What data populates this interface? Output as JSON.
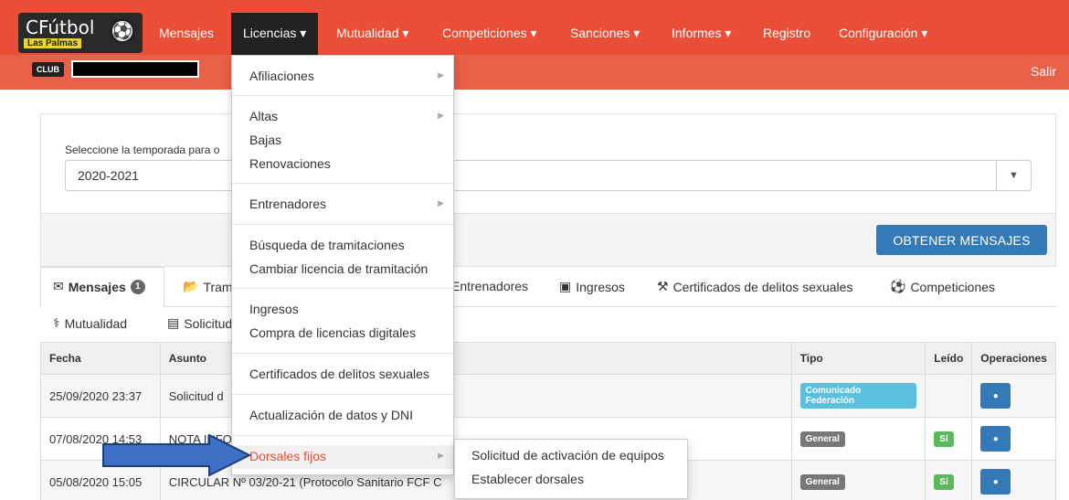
{
  "brand": {
    "title": "CFútbol",
    "subtitle": "Las Palmas"
  },
  "nav": [
    {
      "label": "Mensajes"
    },
    {
      "label": "Licencias ▾"
    },
    {
      "label": "Mutualidad ▾"
    },
    {
      "label": "Competiciones ▾"
    },
    {
      "label": "Sanciones ▾"
    },
    {
      "label": "Informes ▾"
    },
    {
      "label": "Registro"
    },
    {
      "label": "Configuración ▾"
    }
  ],
  "club_bar": {
    "badge": "CLUB",
    "logout": "Salir"
  },
  "season": {
    "label": "Seleccione la temporada para o",
    "value": "2020-2021"
  },
  "actions": {
    "get_messages": "OBTENER MENSAJES"
  },
  "tabs": [
    {
      "label": "Mensajes",
      "badge": "1"
    },
    {
      "label": "Tram"
    },
    {
      "label": "Entrenadores"
    },
    {
      "label": "Ingresos"
    },
    {
      "label": "Certificados de delitos sexuales"
    },
    {
      "label": "Competiciones"
    }
  ],
  "tabs2": [
    {
      "label": "Mutualidad"
    },
    {
      "label": "Solicitud"
    }
  ],
  "table": {
    "headers": [
      "Fecha",
      "Asunto",
      "Tipo",
      "Leído",
      "Operaciones"
    ],
    "rows": [
      {
        "fecha": "25/09/2020 23:37",
        "asunto": "Solicitud d",
        "tipo": "Comunicado Federación",
        "leido": ""
      },
      {
        "fecha": "07/08/2020 14:53",
        "asunto": "NOTA INFO",
        "tipo": "General",
        "leido": "Sí"
      },
      {
        "fecha": "05/08/2020 15:05",
        "asunto": "CIRCULAR Nº 03/20-21 (Protocolo Sanitario FCF C",
        "tipo": "General",
        "leido": "Sí"
      }
    ]
  },
  "dropdown": {
    "items": [
      "Afiliaciones",
      "Altas",
      "Bajas",
      "Renovaciones",
      "Entrenadores",
      "Búsqueda de tramitaciones",
      "Cambiar licencia de tramitación",
      "Ingresos",
      "Compra de licencias digitales",
      "Certificados de delitos sexuales",
      "Actualización de datos y DNI",
      "Dorsales fijos"
    ]
  },
  "submenu": {
    "items": [
      "Solicitud de activación de equipos",
      "Establecer dorsales"
    ]
  },
  "colors": {
    "navbar": "#e94e36",
    "primary": "#337ab7",
    "info": "#5bc0de",
    "success": "#5cb85c"
  },
  "icons": {
    "mail": "envelope-icon",
    "folder": "folder-icon",
    "money": "money-icon",
    "gavel": "gavel-icon",
    "ball": "soccer-ball-icon",
    "stethoscope": "stethoscope-icon",
    "card": "credit-card-icon",
    "eye": "eye-icon",
    "arrow": "arrow-right-icon"
  }
}
